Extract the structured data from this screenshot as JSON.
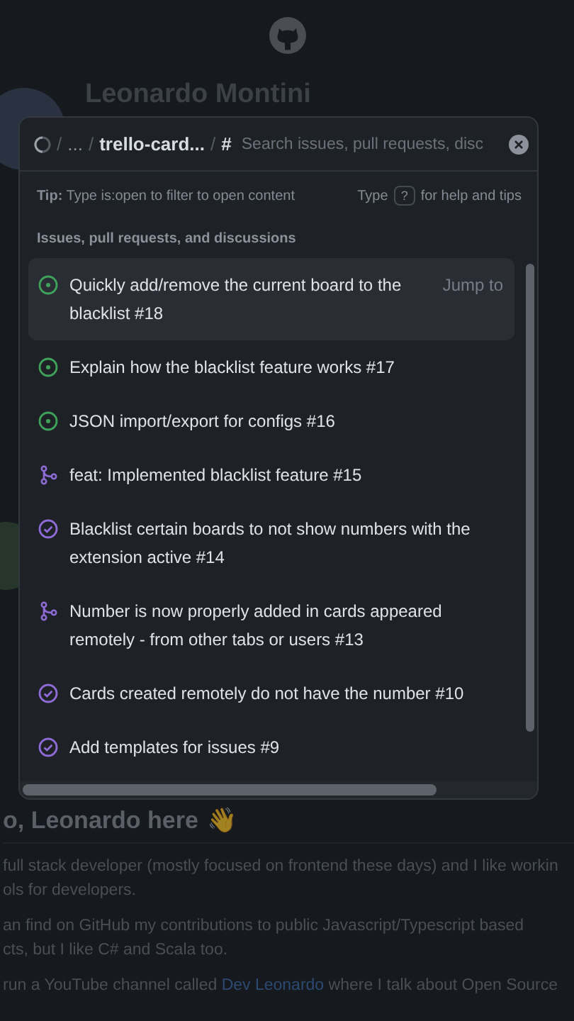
{
  "page": {
    "name": "Leonardo Montini",
    "greeting": "o, Leonardo here",
    "greeting_emoji": "👋",
    "paragraphs": [
      {
        "text": "full stack developer (mostly focused on frontend these days) and I like workin"
      },
      {
        "text": "ols for developers."
      },
      {
        "text": "an find on GitHub my contributions to public Javascript/Typescript based"
      },
      {
        "text": "cts, but I like C# and Scala too."
      },
      {
        "text": "run a YouTube channel called",
        "link": "Dev Leonardo",
        "after": "where I talk about Open Source"
      }
    ]
  },
  "palette": {
    "breadcrumb": [
      {
        "sep": "/",
        "text": "..."
      },
      {
        "sep": "/",
        "text": "trello-card..."
      }
    ],
    "scope_sep": "/",
    "scope_symbol": "#",
    "placeholder": "Search issues, pull requests, disc",
    "tip_label": "Tip:",
    "tip": "Type is:open to filter to open content",
    "help_prefix": "Type",
    "help_key": "?",
    "help_suffix": "for help and tips",
    "section": "Issues, pull requests, and discussions",
    "items": [
      {
        "kind": "issue-open",
        "title": "Quickly add/remove the current board to the blacklist #18",
        "selected": true,
        "hint": "Jump to"
      },
      {
        "kind": "issue-open",
        "title": "Explain how the blacklist feature works #17",
        "selected": false
      },
      {
        "kind": "issue-open",
        "title": "JSON import/export for configs #16",
        "selected": false
      },
      {
        "kind": "pr-merged",
        "title": "feat: Implemented blacklist feature #15",
        "selected": false
      },
      {
        "kind": "issue-closed",
        "title": "Blacklist certain boards to not show numbers with the extension active #14",
        "selected": false
      },
      {
        "kind": "pr-merged",
        "title": "Number is now properly added in cards appeared remotely - from other tabs or users #13",
        "selected": false
      },
      {
        "kind": "issue-closed",
        "title": "Cards created remotely do not have the number #10",
        "selected": false
      },
      {
        "kind": "issue-closed",
        "title": "Add templates for issues #9",
        "selected": false
      }
    ]
  }
}
